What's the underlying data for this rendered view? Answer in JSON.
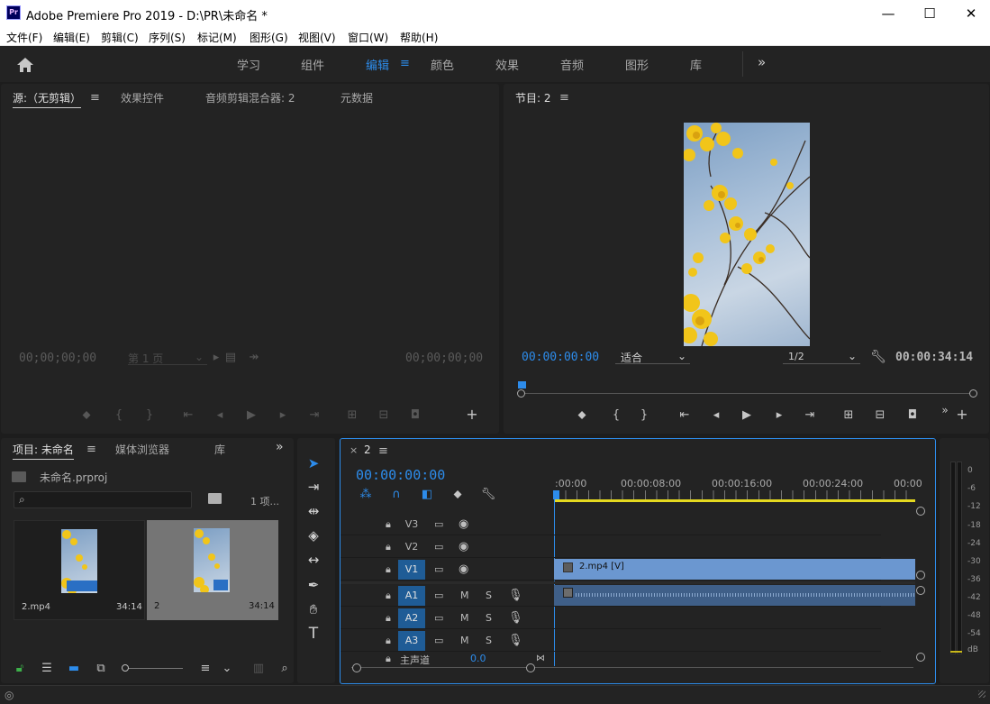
{
  "window": {
    "title": "Adobe Premiere Pro 2019 - D:\\PR\\未命名 *",
    "logo": "Pr",
    "minimize": "—",
    "maximize": "☐",
    "close": "✕"
  },
  "menu": [
    "文件(F)",
    "编辑(E)",
    "剪辑(C)",
    "序列(S)",
    "标记(M)",
    "图形(G)",
    "视图(V)",
    "窗口(W)",
    "帮助(H)"
  ],
  "workspaces": {
    "items": [
      "学习",
      "组件",
      "编辑",
      "颜色",
      "效果",
      "音频",
      "图形",
      "库"
    ],
    "active": "编辑",
    "more": "»"
  },
  "source_panel": {
    "tabs": [
      "源:（无剪辑）",
      "效果控件",
      "音频剪辑混合器: 2",
      "元数据"
    ],
    "timecode_left": "00;00;00;00",
    "timecode_right": "00;00;00;00",
    "page_select": "第 1 页"
  },
  "program_panel": {
    "tab": "节目: 2",
    "timecode_current": "00:00:00:00",
    "fit_select": "适合",
    "resolution_select": "1/2",
    "duration": "00:00:34:14"
  },
  "project_panel": {
    "tabs": [
      "项目: 未命名",
      "媒体浏览器",
      "库"
    ],
    "more": "»",
    "project_file": "未命名.prproj",
    "item_count": "1 项...",
    "items": [
      {
        "name": "2.mp4",
        "duration": "34:14"
      },
      {
        "name": "2",
        "duration": "34:14"
      }
    ]
  },
  "timeline_panel": {
    "tab": "2",
    "close": "×",
    "timecode": "00:00:00:00",
    "ruler": [
      ":00:00",
      "00:00:08:00",
      "00:00:16:00",
      "00:00:24:00",
      "00:00"
    ],
    "video_tracks": [
      "V3",
      "V2",
      "V1"
    ],
    "audio_tracks": [
      "A1",
      "A2",
      "A3"
    ],
    "master_label": "主声道",
    "master_value": "0.0",
    "clip_label": "2.mp4 [V]",
    "mute": "M",
    "solo": "S"
  },
  "audio_meter": {
    "scale": [
      "0",
      "-6",
      "-12",
      "-18",
      "-24",
      "-30",
      "-36",
      "-42",
      "-48",
      "-54",
      "dB"
    ]
  },
  "colors": {
    "accent": "#2d8ceb",
    "panel": "#232323",
    "clip_video": "#6b97d0",
    "clip_audio": "#3f5f88",
    "track_on": "#1f5c96"
  }
}
